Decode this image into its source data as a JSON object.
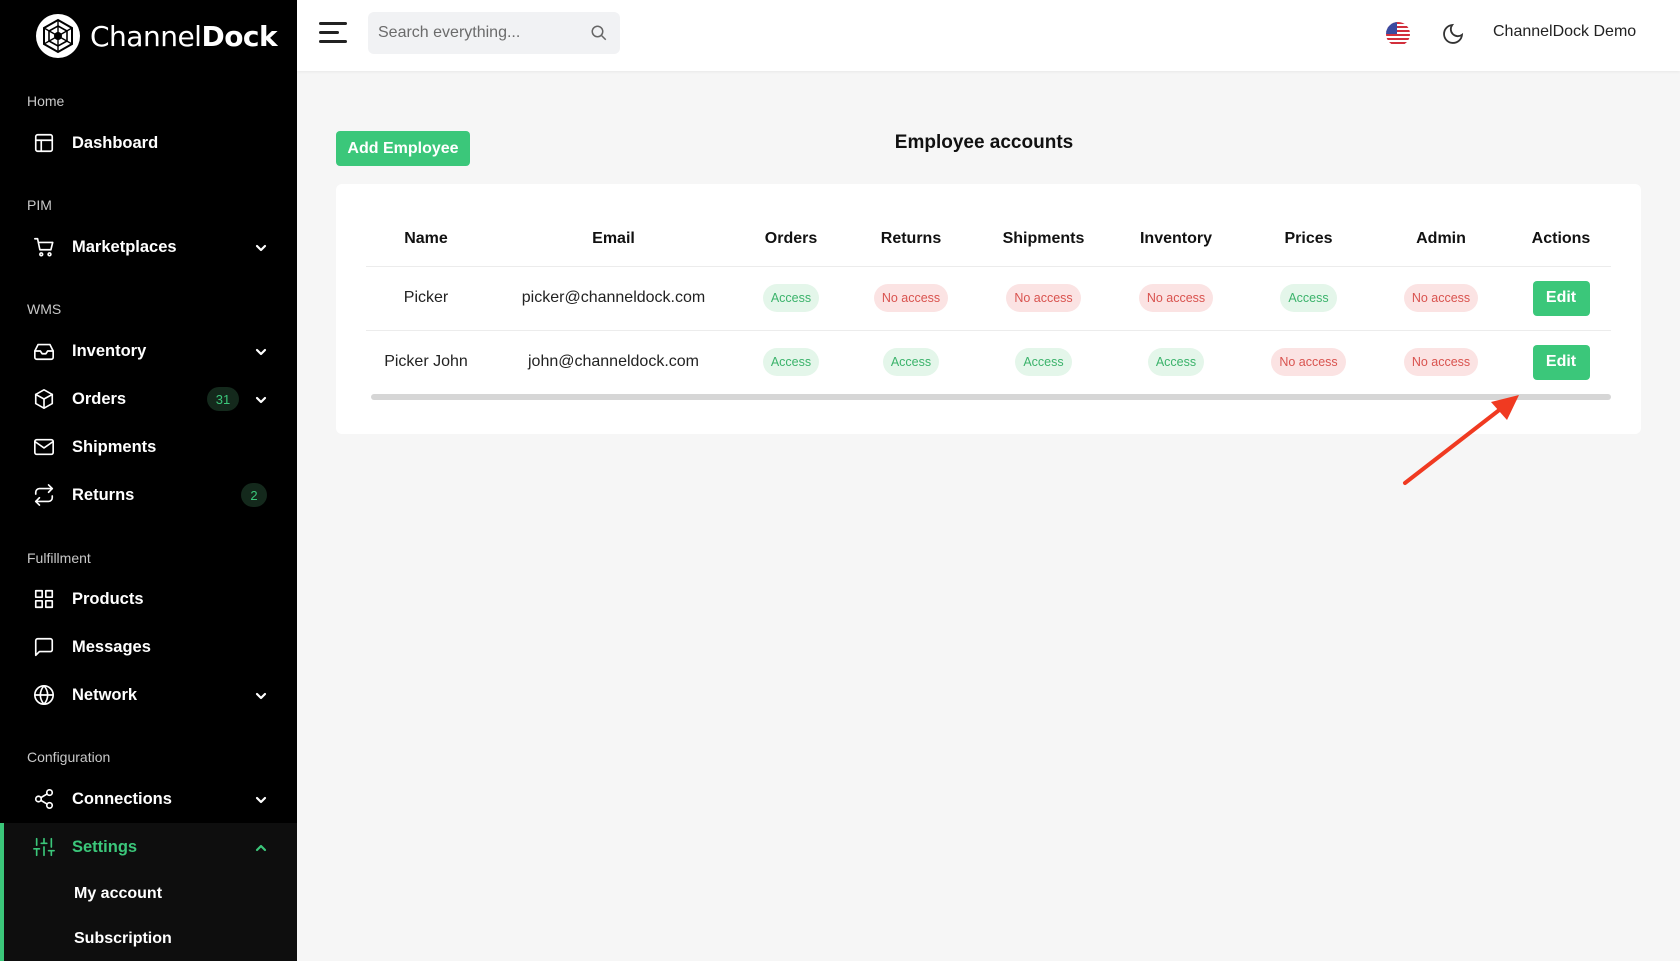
{
  "brand": {
    "name_light": "Channel",
    "name_bold": "Dock"
  },
  "sidebar": {
    "sections": [
      {
        "label": "Home"
      },
      {
        "label": "PIM"
      },
      {
        "label": "WMS"
      },
      {
        "label": "Fulfillment"
      },
      {
        "label": "Configuration"
      }
    ],
    "items": [
      {
        "label": "Dashboard",
        "icon": "dashboard-icon"
      },
      {
        "label": "Marketplaces",
        "icon": "cart-icon"
      },
      {
        "label": "Inventory",
        "icon": "inbox-icon"
      },
      {
        "label": "Orders",
        "icon": "box-icon",
        "badge": "31"
      },
      {
        "label": "Shipments",
        "icon": "mail-icon"
      },
      {
        "label": "Returns",
        "icon": "repeat-icon",
        "badge": "2"
      },
      {
        "label": "Products",
        "icon": "grid-icon"
      },
      {
        "label": "Messages",
        "icon": "message-icon"
      },
      {
        "label": "Network",
        "icon": "globe-icon"
      },
      {
        "label": "Connections",
        "icon": "share-icon"
      },
      {
        "label": "Settings",
        "icon": "sliders-icon"
      }
    ],
    "subitems": [
      {
        "label": "My account"
      },
      {
        "label": "Subscription"
      }
    ]
  },
  "topbar": {
    "search_placeholder": "Search everything...",
    "user_name": "ChannelDock Demo"
  },
  "main": {
    "add_button": "Add Employee",
    "title": "Employee accounts",
    "table": {
      "columns": [
        "Name",
        "Email",
        "Orders",
        "Returns",
        "Shipments",
        "Inventory",
        "Prices",
        "Admin",
        "Actions"
      ],
      "rows": [
        {
          "name": "Picker",
          "email": "picker@channeldock.com",
          "orders": "Access",
          "returns": "No access",
          "shipments": "No access",
          "inventory": "No access",
          "prices": "Access",
          "admin": "No access",
          "action": "Edit"
        },
        {
          "name": "Picker John",
          "email": "john@channeldock.com",
          "orders": "Access",
          "returns": "Access",
          "shipments": "Access",
          "inventory": "Access",
          "prices": "No access",
          "admin": "No access",
          "action": "Edit"
        }
      ]
    }
  },
  "colors": {
    "accent": "#3bc77a",
    "access_bg": "#e4f6ea",
    "access_text": "#3bb36b",
    "noaccess_bg": "#fbe3e3",
    "noaccess_text": "#d9534f",
    "annotation_arrow": "#f03a21"
  }
}
